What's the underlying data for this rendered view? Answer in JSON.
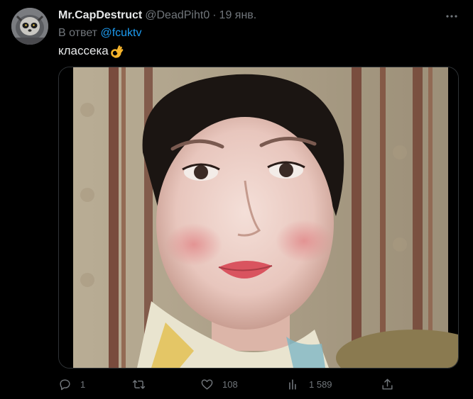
{
  "tweet": {
    "display_name": "Mr.CapDestruct",
    "handle": "@DeadPiht0",
    "separator": "·",
    "date": "19 янв.",
    "reply_prefix": "В ответ",
    "reply_to": "@fcuktv",
    "text": "классека",
    "emoji": "ok-hand-emoji"
  },
  "actions": {
    "reply_count": "1",
    "retweet_count": "",
    "like_count": "108",
    "views_count": "1 589"
  },
  "colors": {
    "background": "#000000",
    "primary_text": "#e7e9ea",
    "secondary_text": "#71767b",
    "link": "#1d9bf0"
  },
  "icons": [
    "more-icon",
    "reply-icon",
    "retweet-icon",
    "like-icon",
    "views-icon",
    "share-icon"
  ]
}
